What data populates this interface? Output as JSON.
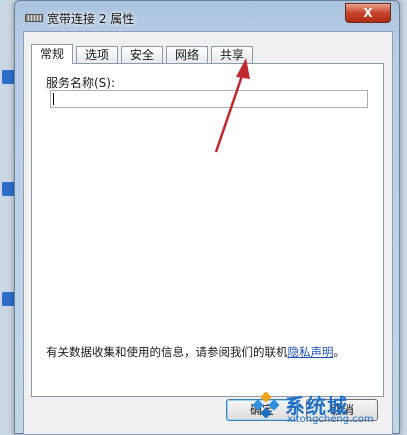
{
  "window": {
    "title": "宽带连接 2 属性",
    "close_label": "X"
  },
  "tabs": [
    {
      "label": "常规",
      "active": true
    },
    {
      "label": "选项",
      "active": false
    },
    {
      "label": "安全",
      "active": false
    },
    {
      "label": "网络",
      "active": false
    },
    {
      "label": "共享",
      "active": false
    }
  ],
  "general": {
    "service_name_label": "服务名称(S):",
    "service_name_value": "",
    "privacy_text": "有关数据收集和使用的信息，请参阅我们的联机",
    "privacy_link": "隐私声明",
    "privacy_period": "。"
  },
  "buttons": {
    "ok": "确定",
    "cancel": "取消"
  },
  "watermark": {
    "logo_text": "系统城",
    "site": "xitongcheng.com"
  },
  "colors": {
    "arrow": "#c0282f",
    "link": "#1a4fb3"
  }
}
